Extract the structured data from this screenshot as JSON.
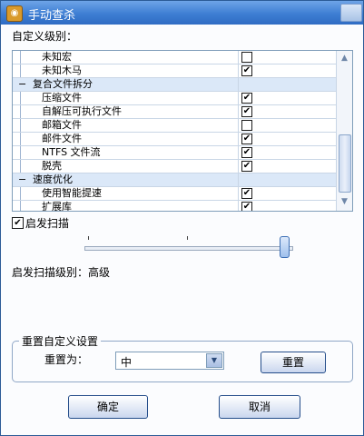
{
  "window": {
    "title": "手动查杀"
  },
  "custom_level_label": "自定义级别：",
  "tree": {
    "rows": [
      {
        "type": "item",
        "label": "未知宏",
        "checked": false
      },
      {
        "type": "item",
        "label": "未知木马",
        "checked": true
      },
      {
        "type": "group",
        "label": "复合文件拆分",
        "collapse": "−"
      },
      {
        "type": "item",
        "label": "压缩文件",
        "checked": true
      },
      {
        "type": "item",
        "label": "自解压可执行文件",
        "checked": true
      },
      {
        "type": "item",
        "label": "邮箱文件",
        "checked": false
      },
      {
        "type": "item",
        "label": "邮件文件",
        "checked": true
      },
      {
        "type": "item",
        "label": "NTFS 文件流",
        "checked": true
      },
      {
        "type": "item",
        "label": "脱壳",
        "checked": true
      },
      {
        "type": "group",
        "label": "速度优化",
        "collapse": "−"
      },
      {
        "type": "item",
        "label": "使用智能提速",
        "checked": true
      },
      {
        "type": "item",
        "label": "扩展库",
        "checked": true
      }
    ]
  },
  "heuristic": {
    "label": "启发扫描",
    "checked": true,
    "level_fraction": 1.0
  },
  "heuristic_level_text": "启发扫描级别：高级",
  "reset_group": {
    "title": "重置自定义设置",
    "reset_to_label": "重置为：",
    "selected": "中",
    "reset_button": "重置"
  },
  "buttons": {
    "ok": "确定",
    "cancel": "取消"
  },
  "colors": {
    "title_bar": "#3e7ed3",
    "group_row": "#dbe8f8",
    "border": "#7f9db9"
  }
}
